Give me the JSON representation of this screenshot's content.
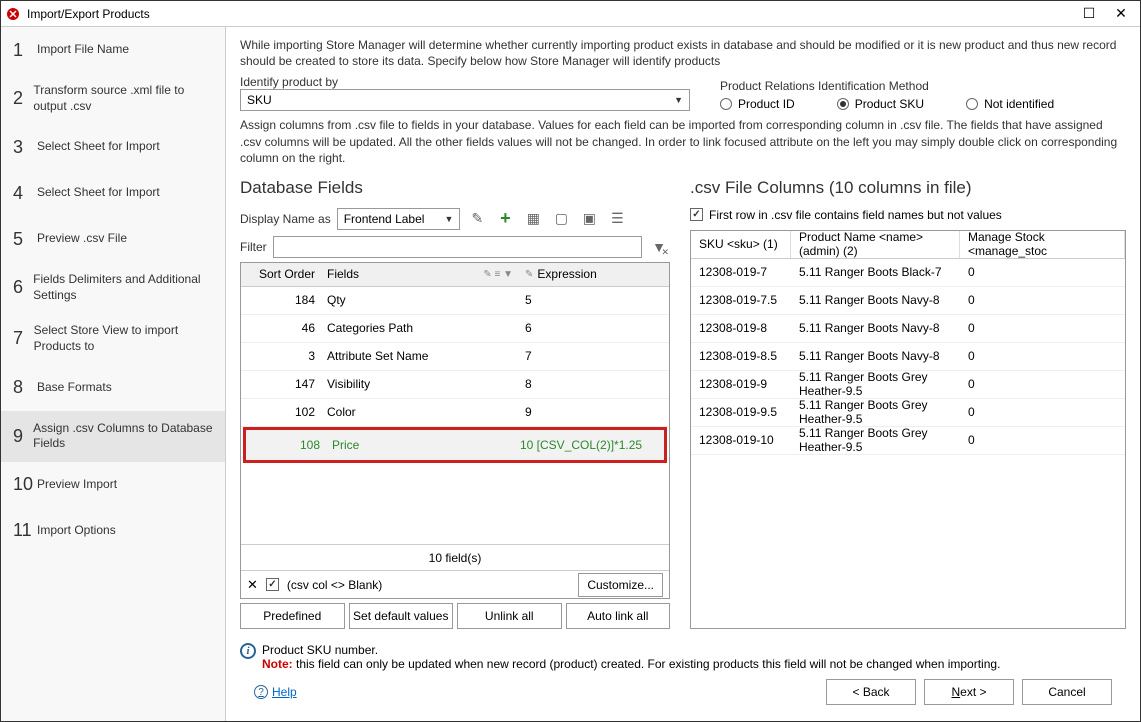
{
  "window": {
    "title": "Import/Export Products"
  },
  "steps": [
    {
      "num": "1",
      "label": "Import File Name"
    },
    {
      "num": "2",
      "label": "Transform source .xml file to output .csv"
    },
    {
      "num": "3",
      "label": "Select Sheet for Import"
    },
    {
      "num": "4",
      "label": "Select Sheet for Import"
    },
    {
      "num": "5",
      "label": "Preview .csv File"
    },
    {
      "num": "6",
      "label": "Fields Delimiters and Additional Settings"
    },
    {
      "num": "7",
      "label": "Select Store View to import Products to"
    },
    {
      "num": "8",
      "label": "Base Formats"
    },
    {
      "num": "9",
      "label": "Assign .csv Columns to Database Fields"
    },
    {
      "num": "10",
      "label": "Preview Import"
    },
    {
      "num": "11",
      "label": "Import Options"
    }
  ],
  "intro1": "While importing Store Manager will determine whether currently importing product exists in database and should be modified or it is new product and thus new record should be created to store its data. Specify below how Store Manager will identify products",
  "identify_label": "Identify product by",
  "identify_value": "SKU",
  "relation_label": "Product Relations Identification Method",
  "radio1": "Product ID",
  "radio2": "Product SKU",
  "radio3": "Not identified",
  "intro2": "Assign columns from .csv file to fields in your database. Values for each field can be imported from corresponding column in .csv file. The fields that have assigned .csv columns will be updated. All the other fields values will not be changed. In order to link focused attribute on the left you may simply double click on corresponding column on the right.",
  "db_title": "Database Fields",
  "csv_title": ".csv File Columns (10 columns in file)",
  "display_label": "Display Name as",
  "display_value": "Frontend Label",
  "filter_label": "Filter",
  "grid_headers": {
    "sort": "Sort Order",
    "fields": "Fields",
    "expr": "Expression"
  },
  "db_rows": [
    {
      "order": "184",
      "field": "Qty",
      "expr": "5"
    },
    {
      "order": "46",
      "field": "Categories Path",
      "expr": "6"
    },
    {
      "order": "3",
      "field": "Attribute Set Name",
      "expr": "7"
    },
    {
      "order": "147",
      "field": "Visibility",
      "expr": "8"
    },
    {
      "order": "102",
      "field": "Color",
      "expr": "9"
    },
    {
      "order": "108",
      "field": "Price",
      "expr": "10 [CSV_COL(2)]*1.25"
    }
  ],
  "grid_footer": "10 field(s)",
  "csv_col_label": "(csv col <> Blank)",
  "customize": "Customize...",
  "btns": {
    "predef": "Predefined",
    "setdef": "Set default values",
    "unlink": "Unlink all",
    "autolink": "Auto link all"
  },
  "firstrow_check": "First row in .csv file contains field names but not values",
  "csv_headers": {
    "sku": "SKU <sku> (1)",
    "name": "Product Name <name> (admin) (2)",
    "stock": "Manage Stock <manage_stoc"
  },
  "csv_rows": [
    {
      "sku": "12308-019-7",
      "name": "5.11 Ranger Boots Black-7",
      "stock": "0"
    },
    {
      "sku": "12308-019-7.5",
      "name": "5.11 Ranger Boots Navy-8",
      "stock": "0"
    },
    {
      "sku": "12308-019-8",
      "name": "5.11 Ranger Boots Navy-8",
      "stock": "0"
    },
    {
      "sku": "12308-019-8.5",
      "name": "5.11 Ranger Boots Navy-8",
      "stock": "0"
    },
    {
      "sku": "12308-019-9",
      "name": "5.11 Ranger Boots Grey Heather-9.5",
      "stock": "0"
    },
    {
      "sku": "12308-019-9.5",
      "name": "5.11 Ranger Boots Grey Heather-9.5",
      "stock": "0"
    },
    {
      "sku": "12308-019-10",
      "name": "5.11 Ranger Boots Grey Heather-9.5",
      "stock": "0"
    }
  ],
  "info1": "Product SKU number.",
  "info2_note": "Note:",
  "info2": " this field can only be updated when new record (product) created. For existing products this field will not be changed when importing.",
  "help": "Help",
  "footer": {
    "back": "< Back",
    "next": "Next >",
    "cancel": "Cancel"
  }
}
